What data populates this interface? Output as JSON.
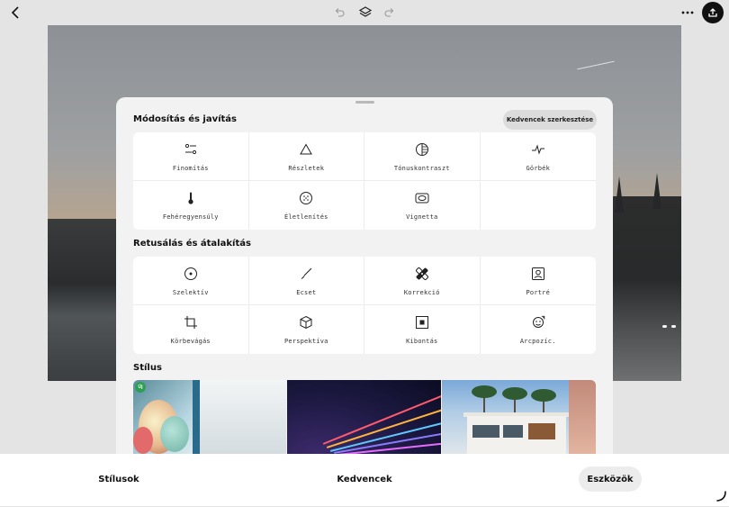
{
  "toolbar": {
    "back_icon": "chevron-left-icon",
    "undo_icon": "undo-icon",
    "layers_icon": "layers-icon",
    "redo_icon": "redo-icon",
    "more_icon": "more-horizontal-icon",
    "export_icon": "upload-icon"
  },
  "sheet": {
    "section1": {
      "title": "Módosítás és javítás",
      "edit_favorites": "Kedvencek szerkesztése",
      "tools": [
        {
          "label": "Finomítás",
          "icon": "tune-sliders-icon"
        },
        {
          "label": "Részletek",
          "icon": "triangle-icon"
        },
        {
          "label": "Tónuskontraszt",
          "icon": "tonal-contrast-icon"
        },
        {
          "label": "Görbék",
          "icon": "curves-icon"
        },
        {
          "label": "Fehéregyensúly",
          "icon": "thermometer-icon"
        },
        {
          "label": "Életlenítés",
          "icon": "blur-dots-icon"
        },
        {
          "label": "Vignetta",
          "icon": "vignette-icon"
        }
      ]
    },
    "section2": {
      "title": "Retusálás és átalakítás",
      "tools": [
        {
          "label": "Szelektív",
          "icon": "selective-target-icon"
        },
        {
          "label": "Ecset",
          "icon": "brush-icon"
        },
        {
          "label": "Korrekció",
          "icon": "healing-bandage-icon"
        },
        {
          "label": "Portré",
          "icon": "portrait-icon"
        },
        {
          "label": "Körbevágás",
          "icon": "crop-icon"
        },
        {
          "label": "Perspektíva",
          "icon": "perspective-cube-icon"
        },
        {
          "label": "Kibontás",
          "icon": "expand-icon"
        },
        {
          "label": "Arcpozíc.",
          "icon": "face-pose-icon"
        }
      ]
    },
    "section3": {
      "title": "Stílus",
      "new_badge": "Új"
    }
  },
  "bottom_nav": {
    "styles": "Stílusok",
    "favorites": "Kedvencek",
    "tools": "Eszközök",
    "active": "Eszközök"
  },
  "colors": {
    "accent_badge": "#2e9e55",
    "sheet_bg": "#f2f2f2"
  }
}
